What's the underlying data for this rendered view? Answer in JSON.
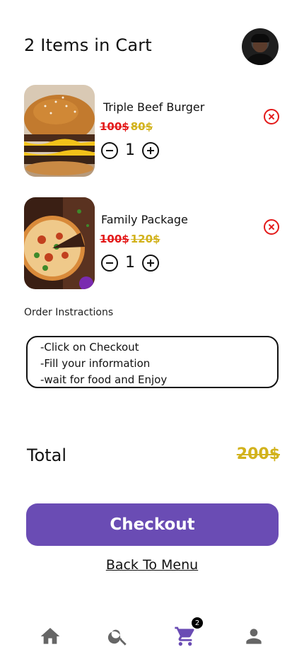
{
  "header": {
    "title": "2 Items in Cart"
  },
  "items": [
    {
      "name": "Triple Beef Burger",
      "old_price": "100$",
      "new_price": "80$",
      "quantity": "1"
    },
    {
      "name": "Family Package",
      "old_price": "100$",
      "new_price": "120$",
      "quantity": "1"
    }
  ],
  "instructions": {
    "label": "Order Instractions",
    "text": "-Click on Checkout\n-Fill your information\n-wait for food and Enjoy"
  },
  "total": {
    "label": "Total",
    "value": "200$"
  },
  "actions": {
    "checkout_label": "Checkout",
    "back_label": "Back To Menu"
  },
  "nav": {
    "cart_badge": "2",
    "active": "cart"
  },
  "colors": {
    "accent": "#6a4cb4",
    "price_old": "#e31a1a",
    "price_new": "#d2b21c",
    "nav_icon": "#666666"
  }
}
